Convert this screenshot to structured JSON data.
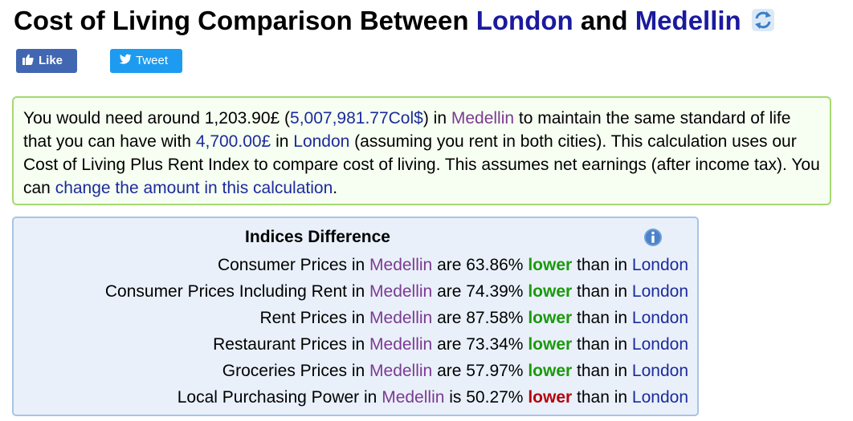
{
  "header": {
    "title_prefix": "Cost of Living Comparison Between ",
    "city1": "London",
    "title_and": " and ",
    "city2": "Medellin"
  },
  "social": {
    "like_label": "Like",
    "tweet_label": "Tweet"
  },
  "summary": {
    "p1": "You would need around 1,203.90£ (",
    "local_amount": "5,007,981.77Col$",
    "p2": ") in ",
    "city2": "Medellin",
    "p3": " to maintain the same standard of life that you can have with ",
    "amount": "4,700.00£",
    "p4": " in ",
    "city1": "London",
    "p5": " (assuming you rent in both cities). This calculation uses our Cost of Living Plus Rent Index to compare cost of living. This assumes net earnings (after income tax). You can ",
    "change_link": "change the amount in this calculation",
    "p6": "."
  },
  "indices": {
    "heading": "Indices Difference",
    "rows": [
      {
        "label": "Consumer Prices",
        "city2": "Medellin",
        "verb": "are",
        "percent": "63.86%",
        "direction": "lower",
        "city1": "London"
      },
      {
        "label": "Consumer Prices Including Rent",
        "city2": "Medellin",
        "verb": "are",
        "percent": "74.39%",
        "direction": "lower",
        "city1": "London"
      },
      {
        "label": "Rent Prices",
        "city2": "Medellin",
        "verb": "are",
        "percent": "87.58%",
        "direction": "lower",
        "city1": "London"
      },
      {
        "label": "Restaurant Prices",
        "city2": "Medellin",
        "verb": "are",
        "percent": "73.34%",
        "direction": "lower",
        "city1": "London"
      },
      {
        "label": "Groceries Prices",
        "city2": "Medellin",
        "verb": "are",
        "percent": "57.97%",
        "direction": "lower",
        "city1": "London"
      },
      {
        "label": "Local Purchasing Power",
        "city2": "Medellin",
        "verb": "is",
        "percent": "50.27%",
        "direction": "lower",
        "city1": "London"
      }
    ],
    "in_word": "in",
    "than_word": "than in"
  },
  "colors": {
    "city_title": "#1b1a9e",
    "city_purple": "#7b3a91",
    "link_blue": "#1c2b9b",
    "lower_green": "#1a9a0b",
    "lower_red": "#b3060c"
  },
  "icons": [
    "refresh-icon",
    "facebook-like-icon",
    "twitter-icon",
    "info-icon"
  ]
}
